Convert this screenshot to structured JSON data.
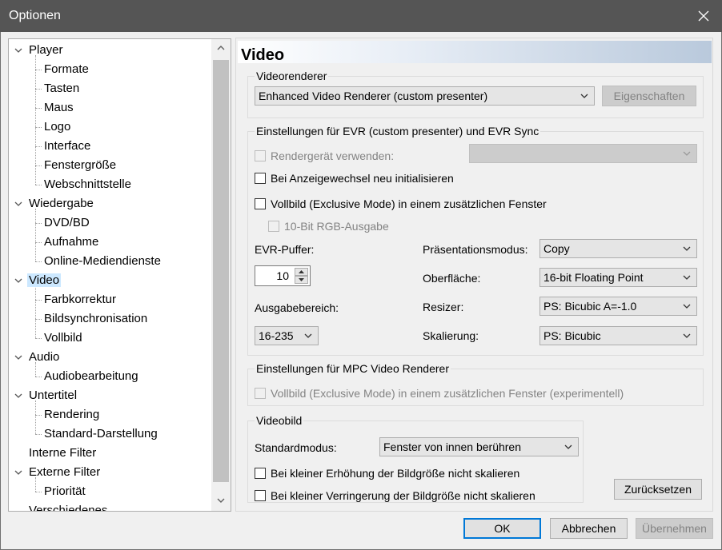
{
  "window": {
    "title": "Optionen",
    "close_icon": "close-icon"
  },
  "tree": {
    "items": [
      {
        "label": "Player",
        "level": 0,
        "expanded": true
      },
      {
        "label": "Formate",
        "level": 1
      },
      {
        "label": "Tasten",
        "level": 1
      },
      {
        "label": "Maus",
        "level": 1
      },
      {
        "label": "Logo",
        "level": 1
      },
      {
        "label": "Interface",
        "level": 1
      },
      {
        "label": "Fenstergröße",
        "level": 1
      },
      {
        "label": "Webschnittstelle",
        "level": 1
      },
      {
        "label": "Wiedergabe",
        "level": 0,
        "expanded": true
      },
      {
        "label": "DVD/BD",
        "level": 1
      },
      {
        "label": "Aufnahme",
        "level": 1
      },
      {
        "label": "Online-Mediendienste",
        "level": 1
      },
      {
        "label": "Video",
        "level": 0,
        "expanded": true,
        "selected": true
      },
      {
        "label": "Farbkorrektur",
        "level": 1
      },
      {
        "label": "Bildsynchronisation",
        "level": 1
      },
      {
        "label": "Vollbild",
        "level": 1
      },
      {
        "label": "Audio",
        "level": 0,
        "expanded": true
      },
      {
        "label": "Audiobearbeitung",
        "level": 1
      },
      {
        "label": "Untertitel",
        "level": 0,
        "expanded": true
      },
      {
        "label": "Rendering",
        "level": 1
      },
      {
        "label": "Standard-Darstellung",
        "level": 1
      },
      {
        "label": "Interne Filter",
        "level": 0
      },
      {
        "label": "Externe Filter",
        "level": 0,
        "expanded": true
      },
      {
        "label": "Priorität",
        "level": 1
      },
      {
        "label": "Verschiedenes",
        "level": 0
      }
    ]
  },
  "panel": {
    "title": "Video",
    "videorenderer": {
      "group_title": "Videorenderer",
      "renderer_value": "Enhanced Video Renderer (custom presenter)",
      "properties_button": "Eigenschaften"
    },
    "evr": {
      "group_title": "Einstellungen für EVR (custom presenter) und EVR Sync",
      "render_device_label": "Rendergerät verwenden:",
      "render_device_value": "",
      "reinit_label": "Bei Anzeigewechsel neu initialisieren",
      "fullscreen_label": "Vollbild (Exclusive Mode) in einem zusätzlichen Fenster",
      "rgb10_label": "10-Bit RGB-Ausgabe",
      "buffer_label": "EVR-Puffer:",
      "buffer_value": "10",
      "output_range_label": "Ausgabebereich:",
      "output_range_value": "16-235",
      "presentation_label": "Präsentationsmodus:",
      "presentation_value": "Copy",
      "surface_label": "Oberfläche:",
      "surface_value": "16-bit Floating Point",
      "resizer_label": "Resizer:",
      "resizer_value": "PS: Bicubic A=-1.0",
      "scaling_label": "Skalierung:",
      "scaling_value": "PS: Bicubic"
    },
    "mpc": {
      "group_title": "Einstellungen für MPC Video Renderer",
      "fullscreen_exp_label": "Vollbild (Exclusive Mode) in einem zusätzlichen Fenster (experimentell)"
    },
    "videobild": {
      "group_title": "Videobild",
      "default_mode_label": "Standardmodus:",
      "default_mode_value": "Fenster von innen berühren",
      "no_scale_increase_label": "Bei kleiner Erhöhung der Bildgröße nicht skalieren",
      "no_scale_decrease_label": "Bei kleiner Verringerung der Bildgröße nicht skalieren"
    },
    "reset_button": "Zurücksetzen"
  },
  "footer": {
    "ok": "OK",
    "cancel": "Abbrechen",
    "apply": "Übernehmen"
  }
}
